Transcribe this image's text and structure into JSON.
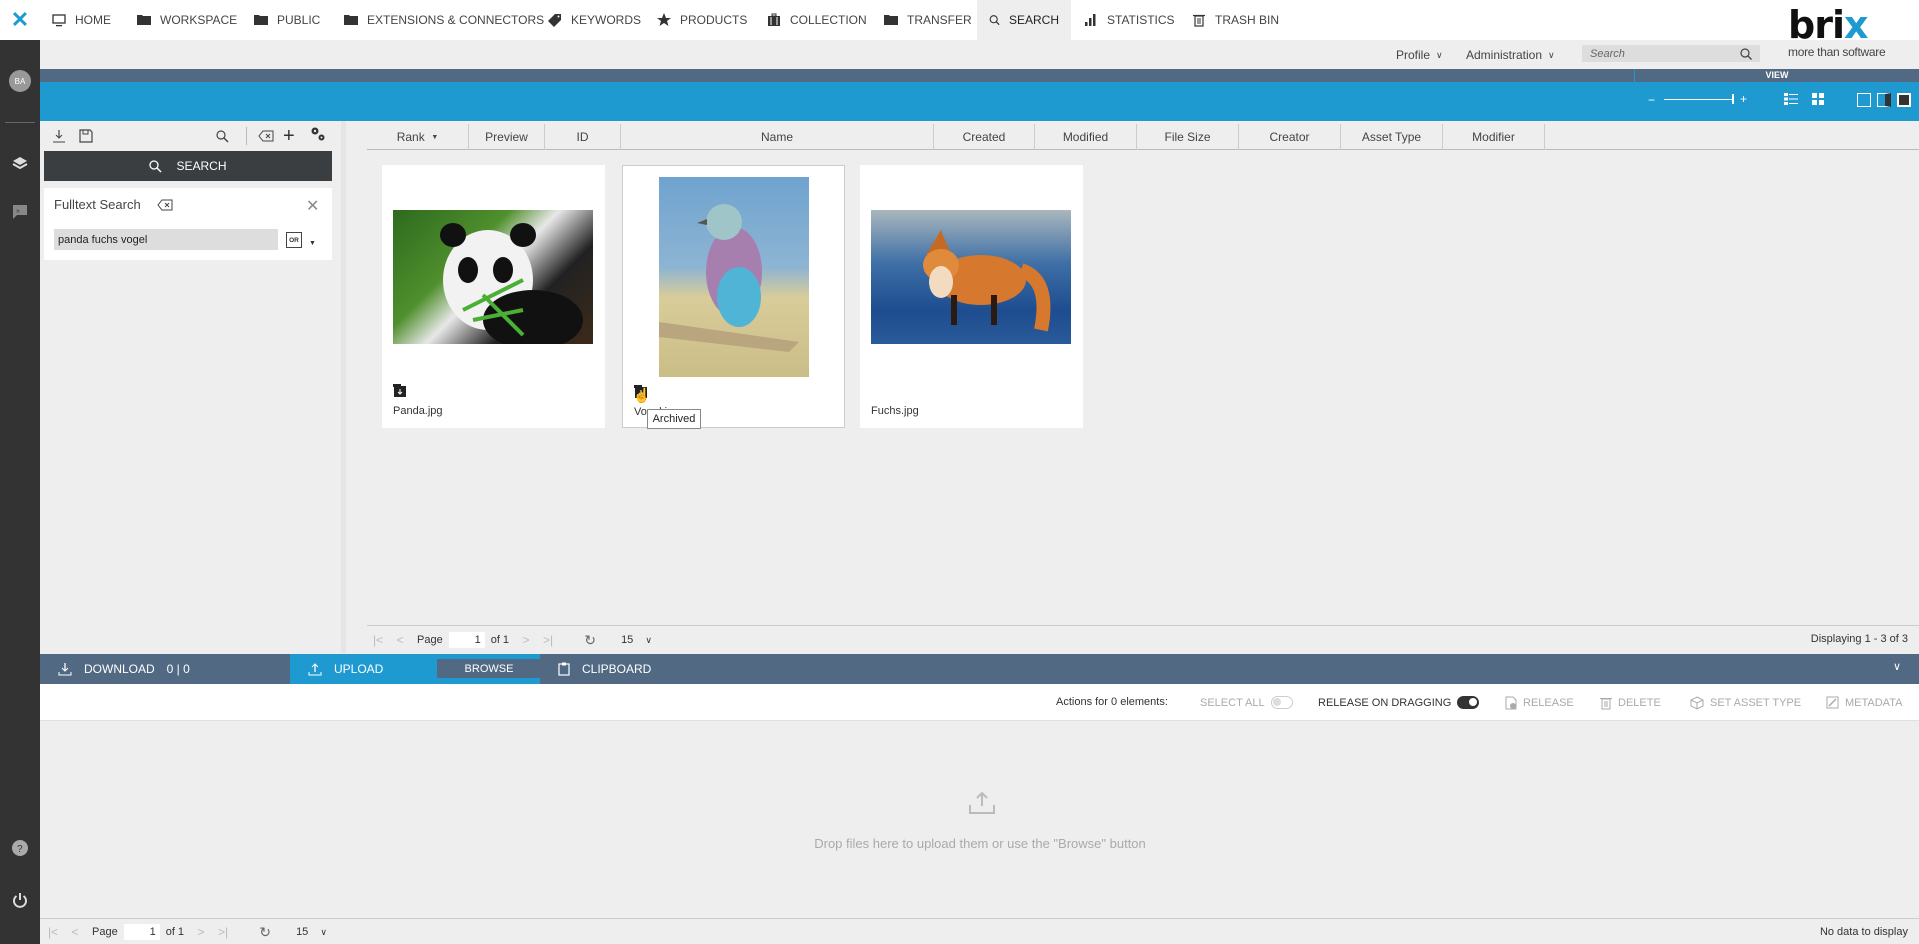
{
  "rail": {
    "logo": "✕",
    "avatar_initials": "BA",
    "icons": [
      "layers-icon",
      "chat-expand-icon",
      "help-icon",
      "power-icon"
    ]
  },
  "nav": {
    "items": [
      {
        "label": "HOME",
        "icon": "monitor-icon"
      },
      {
        "label": "WORKSPACE",
        "icon": "folder-icon"
      },
      {
        "label": "PUBLIC",
        "icon": "folder-icon"
      },
      {
        "label": "EXTENSIONS & CONNECTORS",
        "icon": "folder-icon"
      },
      {
        "label": "KEYWORDS",
        "icon": "tag-icon"
      },
      {
        "label": "PRODUCTS",
        "icon": "star-icon"
      },
      {
        "label": "COLLECTION",
        "icon": "briefcase-icon"
      },
      {
        "label": "TRANSFER",
        "icon": "folder-icon"
      },
      {
        "label": "SEARCH",
        "icon": "search-icon",
        "active": true
      },
      {
        "label": "STATISTICS",
        "icon": "bar-chart-icon"
      },
      {
        "label": "TRASH BIN",
        "icon": "trash-icon"
      }
    ],
    "profile_label": "Profile",
    "admin_label": "Administration",
    "search_placeholder": "Search"
  },
  "brand": {
    "name_a": "bri",
    "name_b": "x",
    "tagline": "more than software"
  },
  "view": {
    "label": "VIEW",
    "zoom_minus": "−",
    "zoom_plus": "+",
    "zoom_level_fraction": 1.0
  },
  "left_panel": {
    "search_button": "SEARCH",
    "fulltext_title": "Fulltext Search",
    "query_value": "panda fuchs vogel",
    "operator": "OR"
  },
  "grid": {
    "columns": [
      "Rank",
      "Preview",
      "ID",
      "Name",
      "Created",
      "Modified",
      "File Size",
      "Creator",
      "Asset Type",
      "Modifier"
    ],
    "sort_column": "Rank",
    "assets": [
      {
        "name": "Panda.jpg",
        "archived": true,
        "subject": "panda"
      },
      {
        "name": "Vogel.jpg",
        "archived": true,
        "subject": "bird",
        "selected": true
      },
      {
        "name": "Fuchs.jpg",
        "archived": false,
        "subject": "fox"
      }
    ],
    "tooltip": "Archived"
  },
  "pager": {
    "page_label": "Page",
    "page": "1",
    "of_label": "of 1",
    "page_size": "15",
    "display_text": "Displaying 1 - 3 of 3"
  },
  "bottom": {
    "download_label": "DOWNLOAD",
    "download_count": "0 | 0",
    "upload_label": "UPLOAD",
    "browse_label": "BROWSE",
    "clipboard_label": "CLIPBOARD",
    "actions_text": "Actions for 0 elements:",
    "select_all": "SELECT ALL",
    "select_all_on": false,
    "release_dragging": "RELEASE ON DRAGGING",
    "release_dragging_on": true,
    "release": "RELEASE",
    "delete": "DELETE",
    "set_asset_type": "SET ASSET TYPE",
    "metadata": "METADATA",
    "drop_text": "Drop files here to upload them or use the \"Browse\" button"
  },
  "bottom_pager": {
    "page_label": "Page",
    "page": "1",
    "of_label": "of 1",
    "page_size": "15",
    "display_text": "No data to display"
  }
}
